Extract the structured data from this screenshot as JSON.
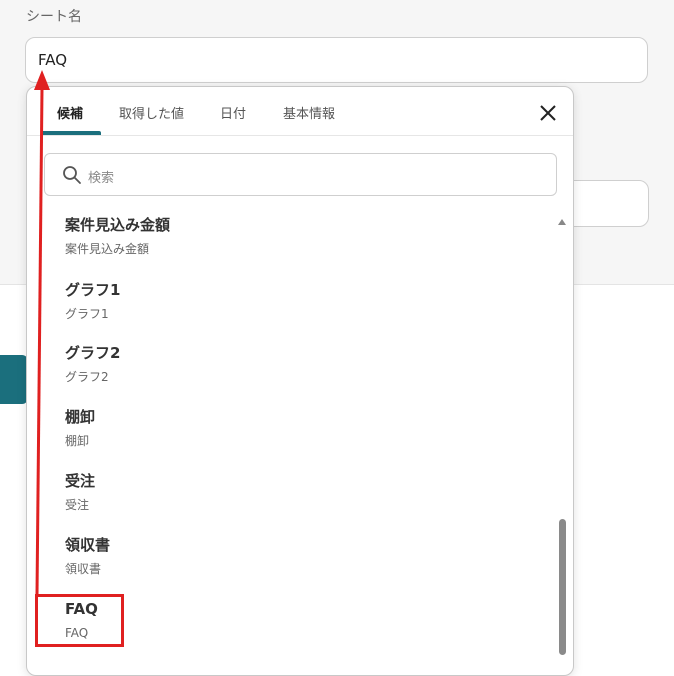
{
  "field": {
    "label": "シート名",
    "value": "FAQ"
  },
  "popup": {
    "tabs": [
      {
        "label": "候補",
        "active": true
      },
      {
        "label": "取得した値",
        "active": false
      },
      {
        "label": "日付",
        "active": false
      },
      {
        "label": "基本情報",
        "active": false
      }
    ],
    "search_placeholder": "検索",
    "items": [
      {
        "title": "案件見込み金額",
        "subtitle": "案件見込み金額"
      },
      {
        "title": "グラフ1",
        "subtitle": "グラフ1"
      },
      {
        "title": "グラフ2",
        "subtitle": "グラフ2"
      },
      {
        "title": "棚卸",
        "subtitle": "棚卸"
      },
      {
        "title": "受注",
        "subtitle": "受注"
      },
      {
        "title": "領収書",
        "subtitle": "領収書"
      },
      {
        "title": "FAQ",
        "subtitle": "FAQ"
      }
    ]
  },
  "colors": {
    "accent": "#1b6f7d",
    "annotation": "#e02020"
  },
  "icons": {
    "close": "close-icon",
    "search": "search-icon"
  }
}
